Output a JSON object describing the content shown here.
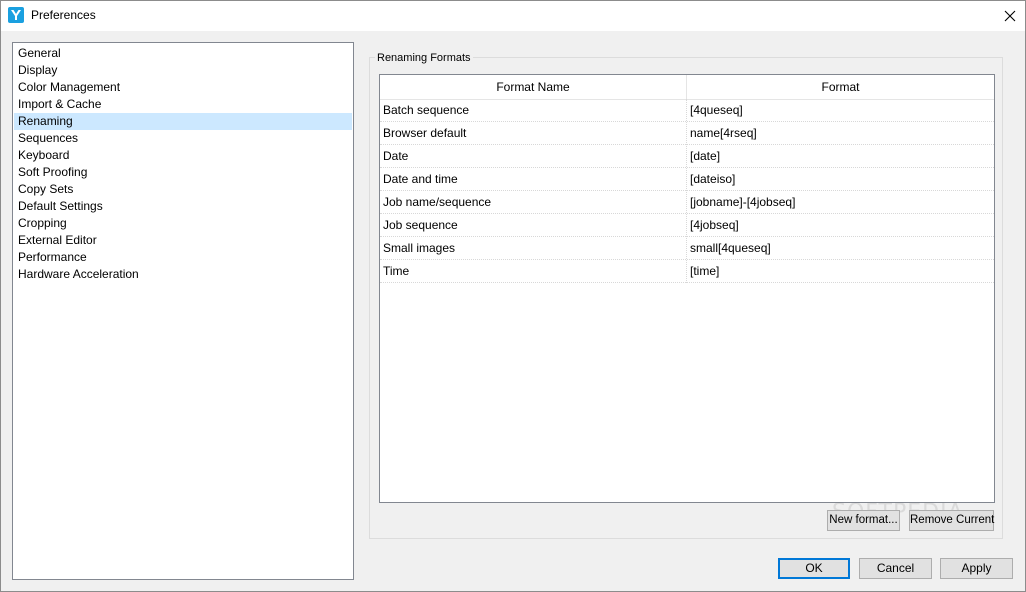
{
  "window": {
    "title": "Preferences",
    "app_icon": "app-logo-icon",
    "close_icon": "close-icon"
  },
  "sidebar": {
    "items": [
      {
        "label": "General"
      },
      {
        "label": "Display"
      },
      {
        "label": "Color Management"
      },
      {
        "label": "Import & Cache"
      },
      {
        "label": "Renaming"
      },
      {
        "label": "Sequences"
      },
      {
        "label": "Keyboard"
      },
      {
        "label": "Soft Proofing"
      },
      {
        "label": "Copy Sets"
      },
      {
        "label": "Default Settings"
      },
      {
        "label": "Cropping"
      },
      {
        "label": "External Editor"
      },
      {
        "label": "Performance"
      },
      {
        "label": "Hardware Acceleration"
      }
    ],
    "selected": "Renaming",
    "selected_color": "#cce8ff"
  },
  "renaming": {
    "group_label": "Renaming Formats",
    "columns": [
      "Format Name",
      "Format"
    ],
    "rows": [
      {
        "name": "Batch sequence",
        "format": "[4queseq]"
      },
      {
        "name": "Browser default",
        "format": "name[4rseq]"
      },
      {
        "name": "Date",
        "format": "[date]"
      },
      {
        "name": "Date and time",
        "format": "[dateiso]"
      },
      {
        "name": "Job name/sequence",
        "format": "[jobname]-[4jobseq]"
      },
      {
        "name": "Job sequence",
        "format": "[4jobseq]"
      },
      {
        "name": "Small images",
        "format": "small[4queseq]"
      },
      {
        "name": "Time",
        "format": "[time]"
      }
    ],
    "new_format_label": "New format...",
    "remove_current_label": "Remove Current"
  },
  "dialog_buttons": {
    "ok": "OK",
    "cancel": "Cancel",
    "apply": "Apply"
  },
  "watermark": "SOFTPEDIA"
}
